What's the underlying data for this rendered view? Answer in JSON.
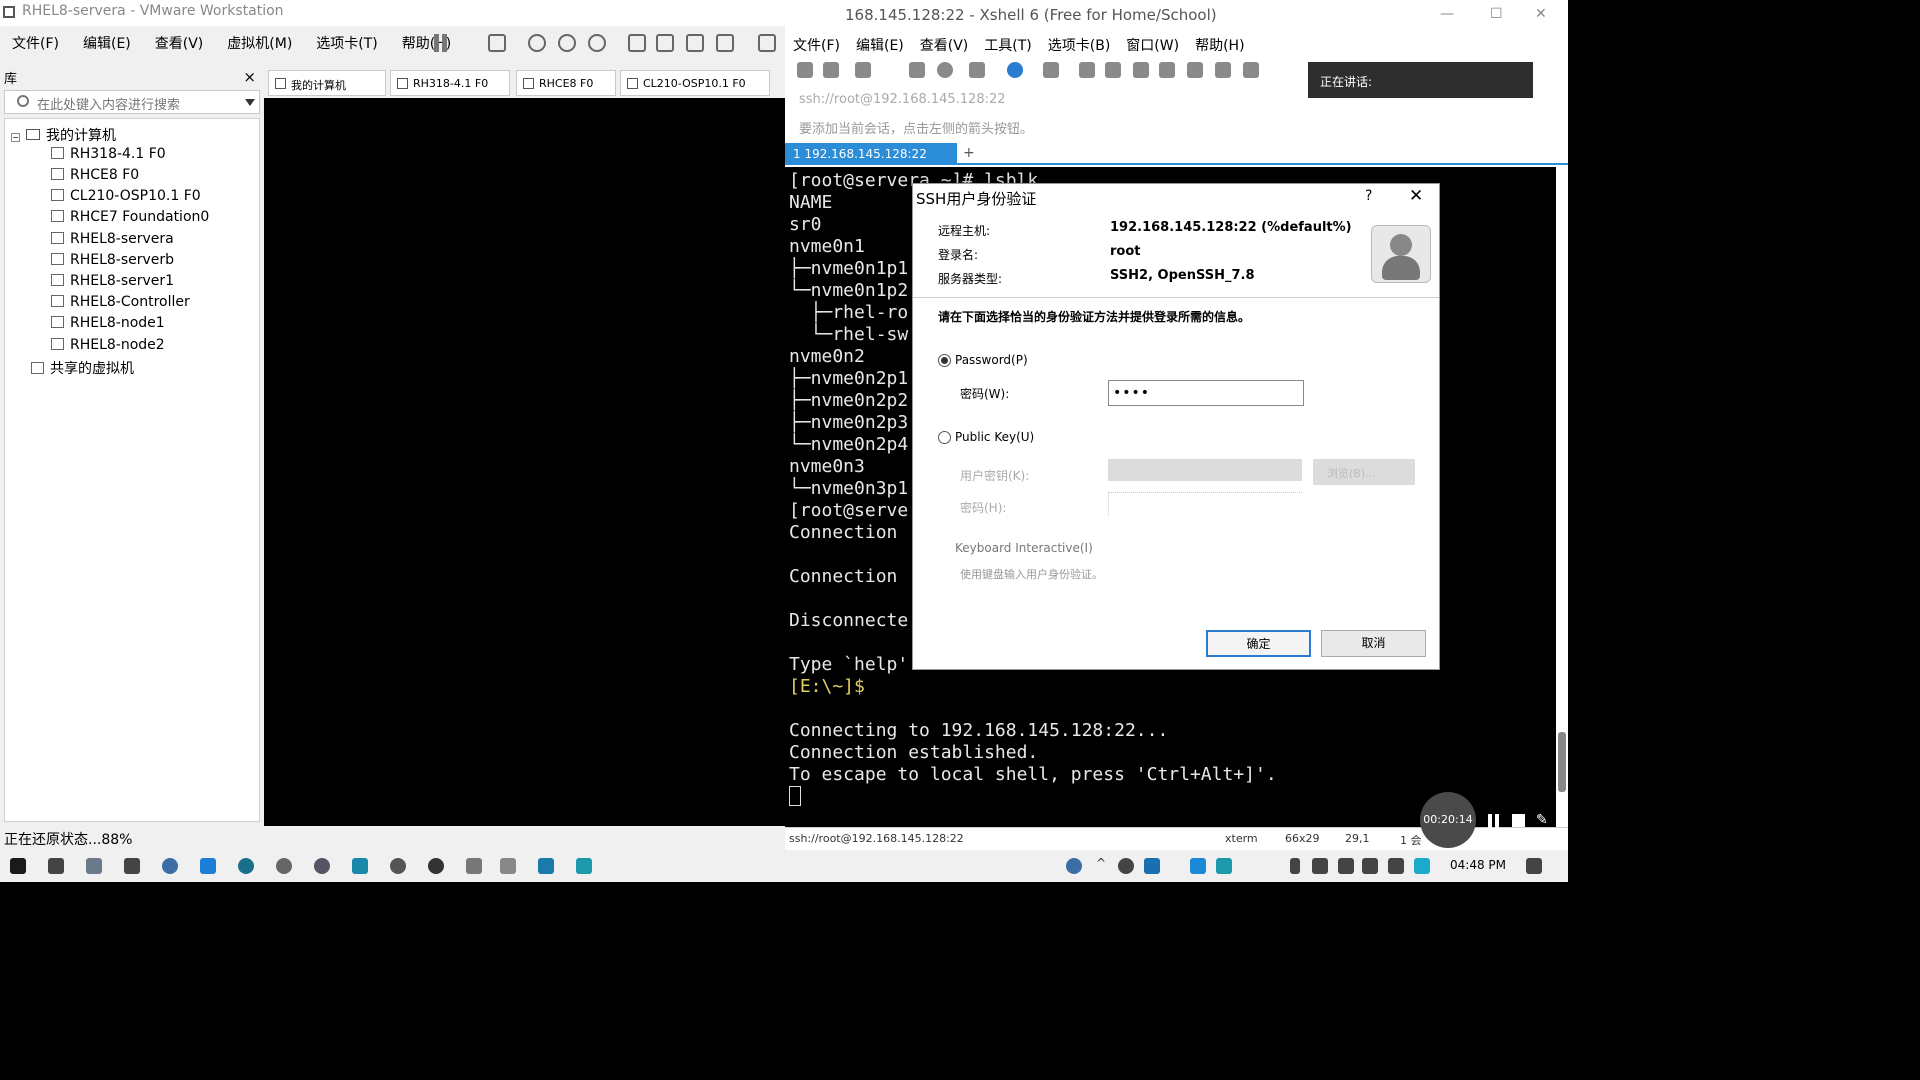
{
  "vmware": {
    "title": "RHEL8-servera - VMware Workstation",
    "menu": [
      "文件(F)",
      "编辑(E)",
      "查看(V)",
      "虚拟机(M)",
      "选项卡(T)",
      "帮助(H)"
    ],
    "library_label": "库",
    "library_close": "×",
    "search_placeholder": "在此处键入内容进行搜索",
    "tree_root": "我的计算机",
    "tree_items": [
      "RH318-4.1 F0",
      "RHCE8 F0",
      "CL210-OSP10.1 F0",
      "RHCE7 Foundation0",
      "RHEL8-servera",
      "RHEL8-serverb",
      "RHEL8-server1",
      "RHEL8-Controller",
      "RHEL8-node1",
      "RHEL8-node2"
    ],
    "tree_shared": "共享的虚拟机",
    "tabs": [
      "我的计算机",
      "RH318-4.1 F0",
      "RHCE8 F0",
      "CL210-OSP10.1 F0"
    ],
    "status": "正在还原状态...88%"
  },
  "xshell": {
    "title": "168.145.128:22 - Xshell 6 (Free for Home/School)",
    "menu": [
      "文件(F)",
      "编辑(E)",
      "查看(V)",
      "工具(T)",
      "选项卡(B)",
      "窗口(W)",
      "帮助(H)"
    ],
    "speaking_label": "正在讲话:",
    "address": "ssh://root@192.168.145.128:22",
    "hint": "要添加当前会话，点击左侧的箭头按钮。",
    "session_tab": "1 192.168.145.128:22",
    "add_tab": "+",
    "terminal_lines": [
      "[root@servera ~]# lsblk",
      "NAME",
      "sr0",
      "nvme0n1",
      "├─nvme0n1p1",
      "└─nvme0n1p2",
      "  ├─rhel-ro",
      "  └─rhel-sw",
      "nvme0n2",
      "├─nvme0n2p1",
      "├─nvme0n2p2",
      "├─nvme0n2p3",
      "└─nvme0n2p4",
      "nvme0n3",
      "└─nvme0n3p1",
      "[root@serve",
      "Connection",
      "",
      "Connection",
      "",
      "Disconnecte                                         7:28.",
      "",
      "Type `help'",
      "[E:\\~]$",
      "",
      "Connecting to 192.168.145.128:22...",
      "Connection established.",
      "To escape to local shell, press 'Ctrl+Alt+]'."
    ],
    "status": {
      "address": "ssh://root@192.168.145.128:22",
      "term": "xterm",
      "size": "66x29",
      "pos": "29,1",
      "sessions": "1 会"
    }
  },
  "dialog": {
    "title": "SSH用户身份验证",
    "help": "?",
    "close": "✕",
    "remote_host_label": "远程主机:",
    "remote_host": "192.168.145.128:22 (%default%)",
    "login_label": "登录名:",
    "login": "root",
    "server_type_label": "服务器类型:",
    "server_type": "SSH2, OpenSSH_7.8",
    "instruction": "请在下面选择恰当的身份验证方法并提供登录所需的信息。",
    "password_option": "Password(P)",
    "password_label": "密码(W):",
    "password_value": "••••",
    "pubkey_option": "Public Key(U)",
    "user_key_label": "用户密钥(K):",
    "browse_label": "浏览(B)...",
    "key_password_label": "密码(H):",
    "kbd_option": "Keyboard Interactive(I)",
    "kbd_desc": "使用键盘输入用户身份验证。",
    "ok": "确定",
    "cancel": "取消"
  },
  "recorder": {
    "time": "00:20:14"
  },
  "taskbar": {
    "clock": "04:48 PM"
  }
}
